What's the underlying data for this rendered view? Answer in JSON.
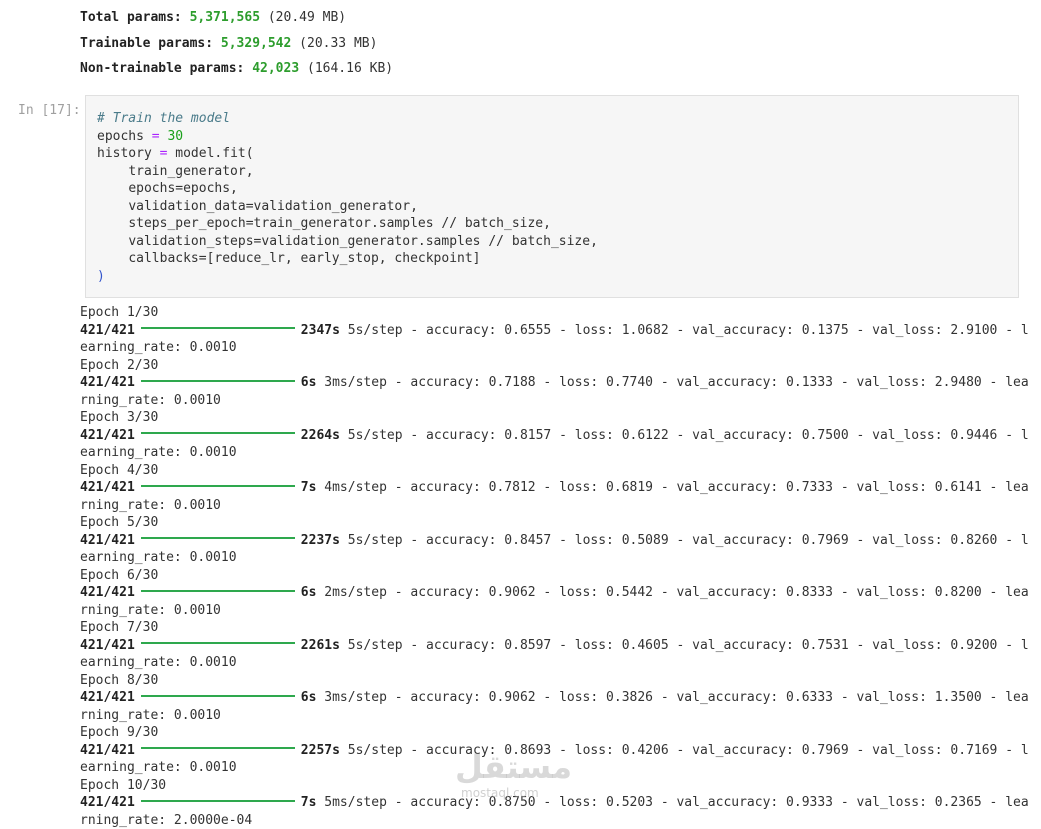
{
  "summary": [
    {
      "label": "Total params:",
      "value": "5,371,565",
      "size": "(20.49 MB)"
    },
    {
      "label": "Trainable params:",
      "value": "5,329,542",
      "size": "(20.33 MB)"
    },
    {
      "label": "Non-trainable params:",
      "value": "42,023",
      "size": "(164.16 KB)"
    }
  ],
  "cell": {
    "prompt": "In [17]:",
    "comment": "# Train the model",
    "epochs_var": "epochs",
    "epochs_val": "30",
    "history_line": "history",
    "fit_call": "model.fit(",
    "args": [
      "train_generator,",
      "epochs=epochs,",
      "validation_data=validation_generator,",
      "steps_per_epoch=train_generator.samples // batch_size,",
      "validation_steps=validation_generator.samples // batch_size,",
      "callbacks=[reduce_lr, early_stop, checkpoint]"
    ],
    "close": ")"
  },
  "output": {
    "epochs": [
      {
        "epoch": "Epoch 1/30",
        "steps": "421/421",
        "time": "2347s",
        "rest": " 5s/step - accuracy: 0.6555 - loss: 1.0682 - val_accuracy: 0.1375 - val_loss: 2.9100 - l",
        "wrap": "earning_rate: 0.0010"
      },
      {
        "epoch": "Epoch 2/30",
        "steps": "421/421",
        "time": "6s",
        "rest": " 3ms/step - accuracy: 0.7188 - loss: 0.7740 - val_accuracy: 0.1333 - val_loss: 2.9480 - lea",
        "wrap": "rning_rate: 0.0010"
      },
      {
        "epoch": "Epoch 3/30",
        "steps": "421/421",
        "time": "2264s",
        "rest": " 5s/step - accuracy: 0.8157 - loss: 0.6122 - val_accuracy: 0.7500 - val_loss: 0.9446 - l",
        "wrap": "earning_rate: 0.0010"
      },
      {
        "epoch": "Epoch 4/30",
        "steps": "421/421",
        "time": "7s",
        "rest": " 4ms/step - accuracy: 0.7812 - loss: 0.6819 - val_accuracy: 0.7333 - val_loss: 0.6141 - lea",
        "wrap": "rning_rate: 0.0010"
      },
      {
        "epoch": "Epoch 5/30",
        "steps": "421/421",
        "time": "2237s",
        "rest": " 5s/step - accuracy: 0.8457 - loss: 0.5089 - val_accuracy: 0.7969 - val_loss: 0.8260 - l",
        "wrap": "earning_rate: 0.0010"
      },
      {
        "epoch": "Epoch 6/30",
        "steps": "421/421",
        "time": "6s",
        "rest": " 2ms/step - accuracy: 0.9062 - loss: 0.5442 - val_accuracy: 0.8333 - val_loss: 0.8200 - lea",
        "wrap": "rning_rate: 0.0010"
      },
      {
        "epoch": "Epoch 7/30",
        "steps": "421/421",
        "time": "2261s",
        "rest": " 5s/step - accuracy: 0.8597 - loss: 0.4605 - val_accuracy: 0.7531 - val_loss: 0.9200 - l",
        "wrap": "earning_rate: 0.0010"
      },
      {
        "epoch": "Epoch 8/30",
        "steps": "421/421",
        "time": "6s",
        "rest": " 3ms/step - accuracy: 0.9062 - loss: 0.3826 - val_accuracy: 0.6333 - val_loss: 1.3500 - lea",
        "wrap": "rning_rate: 0.0010"
      },
      {
        "epoch": "Epoch 9/30",
        "steps": "421/421",
        "time": "2257s",
        "rest": " 5s/step - accuracy: 0.8693 - loss: 0.4206 - val_accuracy: 0.7969 - val_loss: 0.7169 - l",
        "wrap": "earning_rate: 0.0010"
      },
      {
        "epoch": "Epoch 10/30",
        "steps": "421/421",
        "time": "7s",
        "rest": " 5ms/step - accuracy: 0.8750 - loss: 0.5203 - val_accuracy: 0.9333 - val_loss: 0.2365 - lea",
        "wrap": "rning_rate: 2.0000e-04"
      }
    ]
  },
  "watermark": {
    "arabic": "مستقل",
    "latin": "mostaql.com"
  }
}
